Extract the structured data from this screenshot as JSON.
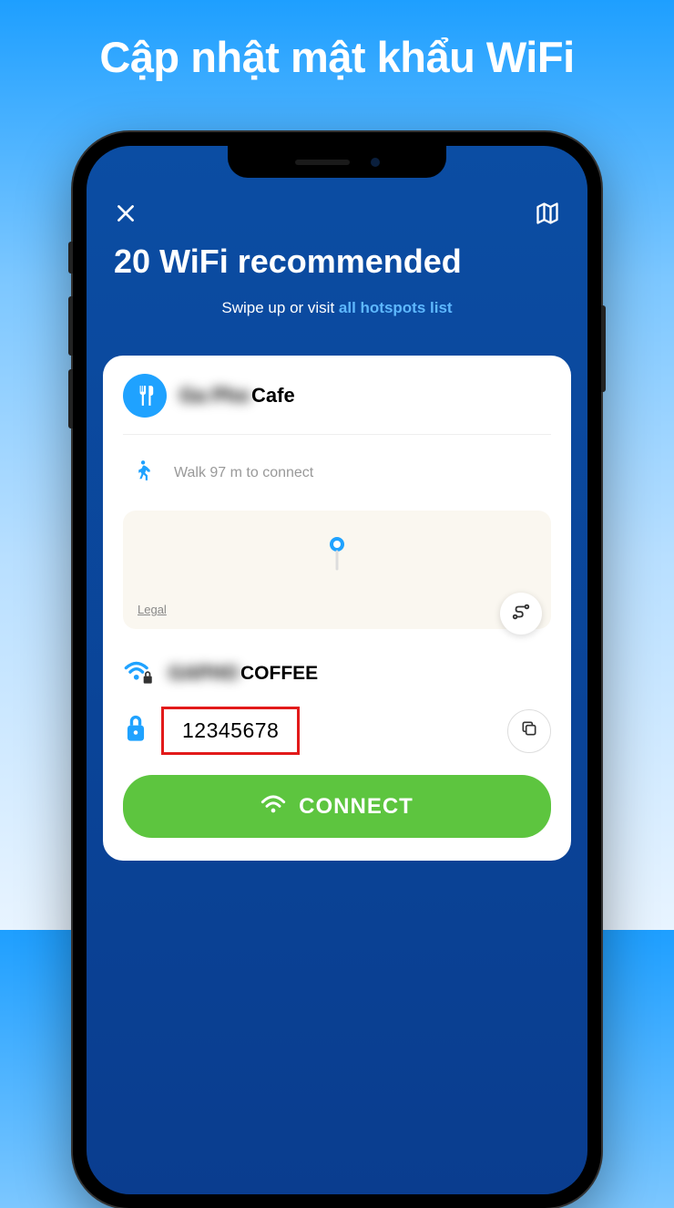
{
  "page": {
    "title": "Cập nhật mật khẩu WiFi"
  },
  "app": {
    "header_title": "20 WiFi recommended",
    "subtitle_prefix": "Swipe up or visit ",
    "subtitle_link": "all hotspots list"
  },
  "cafe": {
    "name_blur": "Ga Pho",
    "name_visible": "Cafe"
  },
  "walk": {
    "text": "Walk 97 m to connect"
  },
  "map": {
    "legal": "Legal"
  },
  "wifi": {
    "name_blur": "GAPHO",
    "name_visible": "COFFEE",
    "password": "12345678"
  },
  "connect": {
    "label": "CONNECT"
  }
}
